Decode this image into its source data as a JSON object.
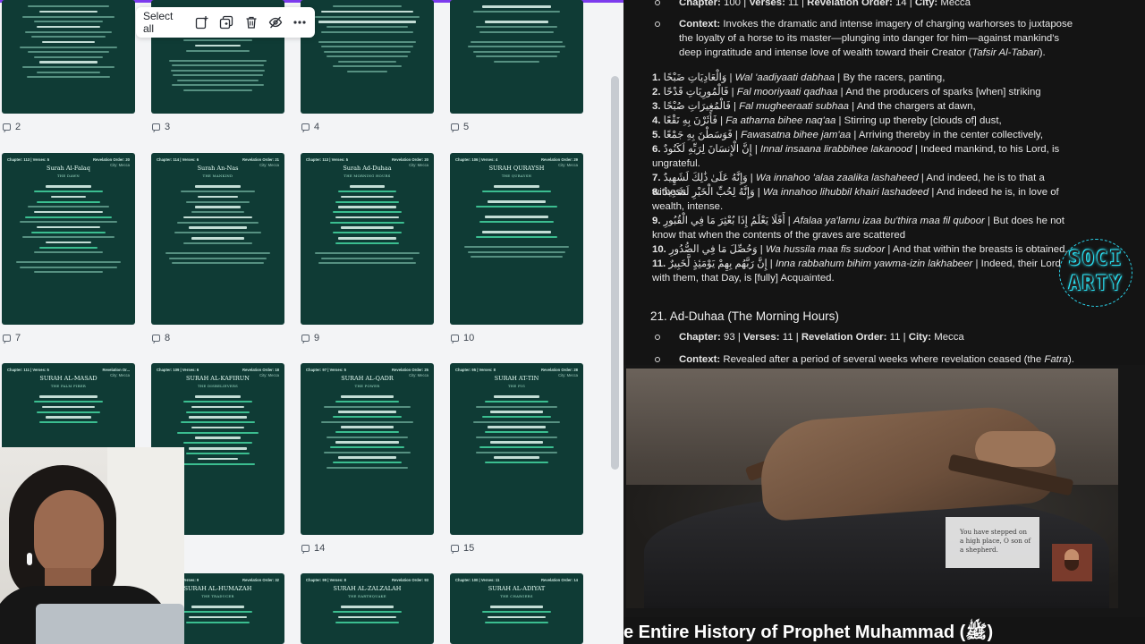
{
  "toolbar": {
    "select_all_label": "Select all",
    "icons": [
      "add-icon",
      "duplicate-icon",
      "trash-icon",
      "hide-icon",
      "more-icon"
    ]
  },
  "slides": {
    "row1": [
      {
        "num": "2",
        "head_left": "",
        "head_right": "",
        "title": "",
        "sub": ""
      },
      {
        "num": "3",
        "head_left": "",
        "head_right": "",
        "title": "",
        "sub": ""
      },
      {
        "num": "4",
        "head_left": "",
        "head_right": "",
        "title": "",
        "sub": ""
      },
      {
        "num": "5",
        "head_left": "",
        "head_right": "",
        "title": "",
        "sub": ""
      }
    ],
    "row2": [
      {
        "num": "7",
        "head_left": "Chapter: 113 | Verses: 5",
        "head_right": "Revelation Order: 20",
        "city": "City: Mecca",
        "title": "Surah Al-Falaq",
        "sub": "THE DAWN"
      },
      {
        "num": "8",
        "head_left": "Chapter: 114 | Verses: 6",
        "head_right": "Revelation Order: 21",
        "city": "City: Mecca",
        "title": "Surah An-Nas",
        "sub": "THE MANKIND"
      },
      {
        "num": "9",
        "head_left": "Chapter: 113 | Verses: 5",
        "head_right": "Revelation Order: 20",
        "city": "City: Mecca",
        "title": "Surah Ad-Duhaa",
        "sub": "THE MORNING HOURS"
      },
      {
        "num": "10",
        "head_left": "Chapter: 106 | Verses: 4",
        "head_right": "Revelation Order: 29",
        "city": "City: Mecca",
        "title": "SURAH QURAYSH",
        "sub": "THE QURAYSH"
      }
    ],
    "row3": [
      {
        "num": "",
        "head_left": "Chapter: 111 | Verses: 5",
        "head_right": "Revelation Or...",
        "city": "City: Mecca",
        "title": "SURAH AL-MASAD",
        "sub": "THE PALM FIBER"
      },
      {
        "num": "",
        "head_left": "Chapter: 109 | Verses: 6",
        "head_right": "Revelation Order: 18",
        "city": "City: Mecca",
        "title": "SURAH AL-KAFIRUN",
        "sub": "THE DISBELIEVERS"
      },
      {
        "num": "14",
        "head_left": "Chapter: 97 | Verses: 5",
        "head_right": "Revelation Order: 25",
        "city": "City: Mecca",
        "title": "SURAH AL-QADR",
        "sub": "THE POWER"
      },
      {
        "num": "15",
        "head_left": "Chapter: 95 | Verses: 8",
        "head_right": "Revelation Order: 28",
        "city": "City: Mecca",
        "title": "SURAH AT-TIN",
        "sub": "THE FIG"
      }
    ],
    "row4": [
      {
        "title": "SURAH AL-HUMAZAH",
        "sub": "THE TRADUCER",
        "head_left": "Chapter: 104 | Verses: 9",
        "head_right": "Revelation Order: 32"
      },
      {
        "title": "SURAH AL-ZALZALAH",
        "sub": "THE EARTHQUAKE",
        "head_left": "Chapter: 99 | Verses: 8",
        "head_right": "Revelation Order: 93"
      },
      {
        "title": "SURAH AL-ADIYAT",
        "sub": "THE CHARGERS",
        "head_left": "Chapter: 100 | Verses: 11",
        "head_right": "Revelation Order: 14"
      }
    ]
  },
  "doc": {
    "top_line": {
      "chapter_label": "Chapter:",
      "chapter": "100",
      "verses_label": "Verses:",
      "verses": "11",
      "order_label": "Revelation Order:",
      "order": "14",
      "city_label": "City:",
      "city": "Mecca"
    },
    "context": {
      "label": "Context:",
      "text": "Invokes the dramatic and intense imagery of charging warhorses to juxtapose the loyalty of a horse to its master—plunging into danger for him—against mankind's deep ingratitude and intense love of wealth toward their Creator (",
      "ref": "Tafsir Al-Tabari",
      "end": ")."
    },
    "verses": [
      {
        "n": "1.",
        "ar": "وَالْعَادِيَاتِ ضَبْحًا",
        "tr": "Wal 'aadiyaati dabhaa",
        "en": "By the racers, panting,"
      },
      {
        "n": "2.",
        "ar": "فَالْمُورِيَاتِ قَدْحًا",
        "tr": "Fal mooriyaati qadhaa",
        "en": "And the producers of sparks [when] striking"
      },
      {
        "n": "3.",
        "ar": "فَالْمُغِيرَاتِ صُبْحًا",
        "tr": "Fal mugheeraati subhaa",
        "en": "And the chargers at dawn,"
      },
      {
        "n": "4.",
        "ar": "فَأَثَرْنَ بِهِ نَقْعًا",
        "tr": "Fa atharna bihee naq'aa",
        "en": "Stirring up thereby [clouds of] dust,"
      },
      {
        "n": "5.",
        "ar": "فَوَسَطْنَ بِهِ جَمْعًا",
        "tr": "Fawasatna bihee jam'aa",
        "en": "Arriving thereby in the center collectively,"
      },
      {
        "n": "6.",
        "ar": "إِنَّ الْإِنسَانَ لِرَبِّهِ لَكَنُودٌ",
        "tr": "Innal insaana lirabbihee lakanood",
        "en": "Indeed mankind, to his Lord, is ungrateful."
      },
      {
        "n": "7.",
        "ar": "وَإِنَّهُ عَلَىٰ ذَٰلِكَ لَشَهِيدٌ",
        "tr": "Wa innahoo 'alaa zaalika lashaheed",
        "en": "And indeed, he is to that a witness."
      },
      {
        "n": "8.",
        "ar": "وَإِنَّهُ لِحُبِّ الْخَيْرِ لَشَدِيدٌ",
        "tr": "Wa innahoo lihubbil khairi lashadeed",
        "en": "And indeed he is, in love of wealth, intense."
      },
      {
        "n": "9.",
        "ar": "أَفَلَا يَعْلَمُ إِذَا بُعْثِرَ مَا فِي الْقُبُورِ",
        "tr": "Afalaa ya'lamu izaa bu'thira maa fil quboor",
        "en": "But does he not know that when the contents of the graves are scattered"
      },
      {
        "n": "10.",
        "ar": "وَحُصِّلَ مَا فِي الصُّدُورِ",
        "tr": "Wa hussila maa fis sudoor",
        "en": "And that within the breasts is obtained,"
      },
      {
        "n": "11.",
        "ar": "إِنَّ رَبَّهُم بِهِمْ يَوْمَئِذٍ لَّخَبِيرٌ",
        "tr": "Inna rabbahum bihim yawma-izin lakhabeer",
        "en": "Indeed, their Lord with them, that Day, is [fully] Acquainted."
      }
    ],
    "section_title": "21. Ad-Duhaa (The Morning Hours)",
    "sec_line": {
      "chapter_label": "Chapter:",
      "chapter": "93",
      "verses_label": "Verses:",
      "verses": "11",
      "order_label": "Revelation Order:",
      "order": "11",
      "city_label": "City:",
      "city": "Mecca"
    },
    "sec_context": {
      "label": "Context:",
      "text": "Revealed after a period of several weeks where revelation ceased (the ",
      "ref": "Fatra",
      "end": ")."
    }
  },
  "logo": {
    "line1": "SOCI",
    "line2": "ARTY"
  },
  "video": {
    "caption": "You have stepped on a high place, O son of a shepherd."
  },
  "video_title": "e Entire History of Prophet Muhammad (ﷺ)",
  "colors": {
    "slide_bg": "#0f3b35",
    "accent_top": "#7c3aed",
    "logo_glow": "#2be3f5"
  }
}
